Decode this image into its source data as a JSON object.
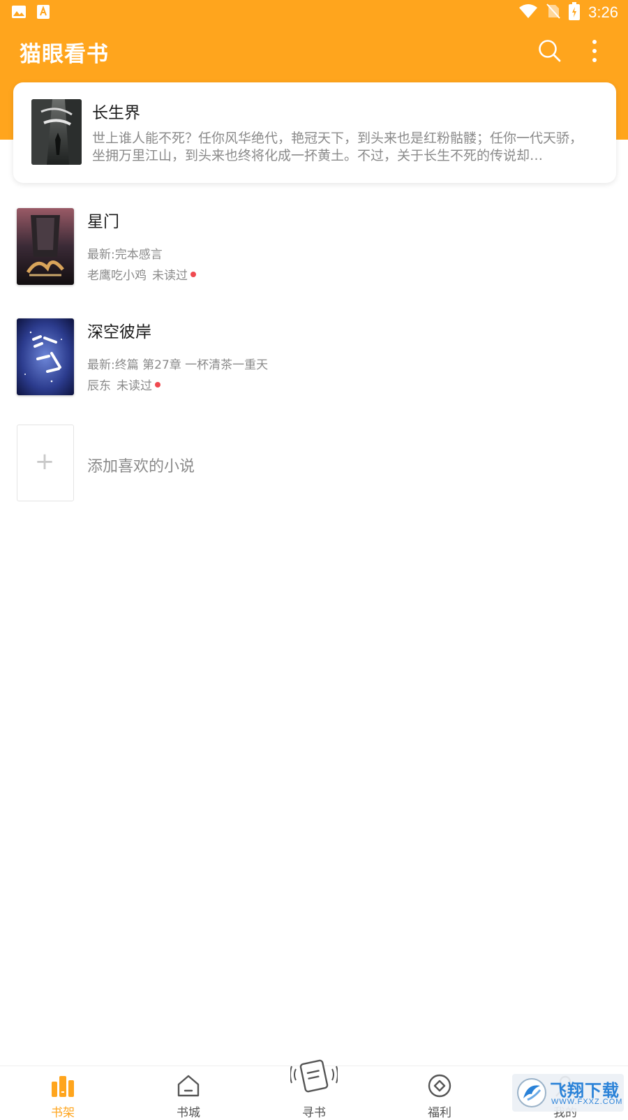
{
  "status_bar": {
    "time": "3:26"
  },
  "header": {
    "app_title": "猫眼看书"
  },
  "featured": {
    "title": "长生界",
    "description": "世上谁人能不死？任你风华绝代，艳冠天下，到头来也是红粉骷髅；任你一代天骄，坐拥万里江山，到头来也终将化成一抔黄土。不过，关于长生不死的传说却…"
  },
  "books": [
    {
      "title": "星门",
      "latest": "最新:完本感言",
      "author": "老鹰吃小鸡",
      "status": "未读过"
    },
    {
      "title": "深空彼岸",
      "latest": "最新:终篇 第27章 一杯清茶一重天",
      "author": "辰东",
      "status": "未读过"
    }
  ],
  "add_book": {
    "plus": "+",
    "label": "添加喜欢的小说"
  },
  "nav": {
    "items": [
      {
        "label": "书架",
        "icon": "bookshelf-icon",
        "active": true
      },
      {
        "label": "书城",
        "icon": "home-icon",
        "active": false
      },
      {
        "label": "寻书",
        "icon": "find-book-icon",
        "active": false
      },
      {
        "label": "福利",
        "icon": "welfare-icon",
        "active": false
      },
      {
        "label": "我的",
        "icon": "profile-icon",
        "active": false
      }
    ]
  },
  "watermark": {
    "text": "飞翔下载",
    "url": "WWW.FXXZ.COM"
  },
  "colors": {
    "accent": "#FFA51D",
    "dot": "#F0494F",
    "secondary_text": "#8a8a8a"
  }
}
